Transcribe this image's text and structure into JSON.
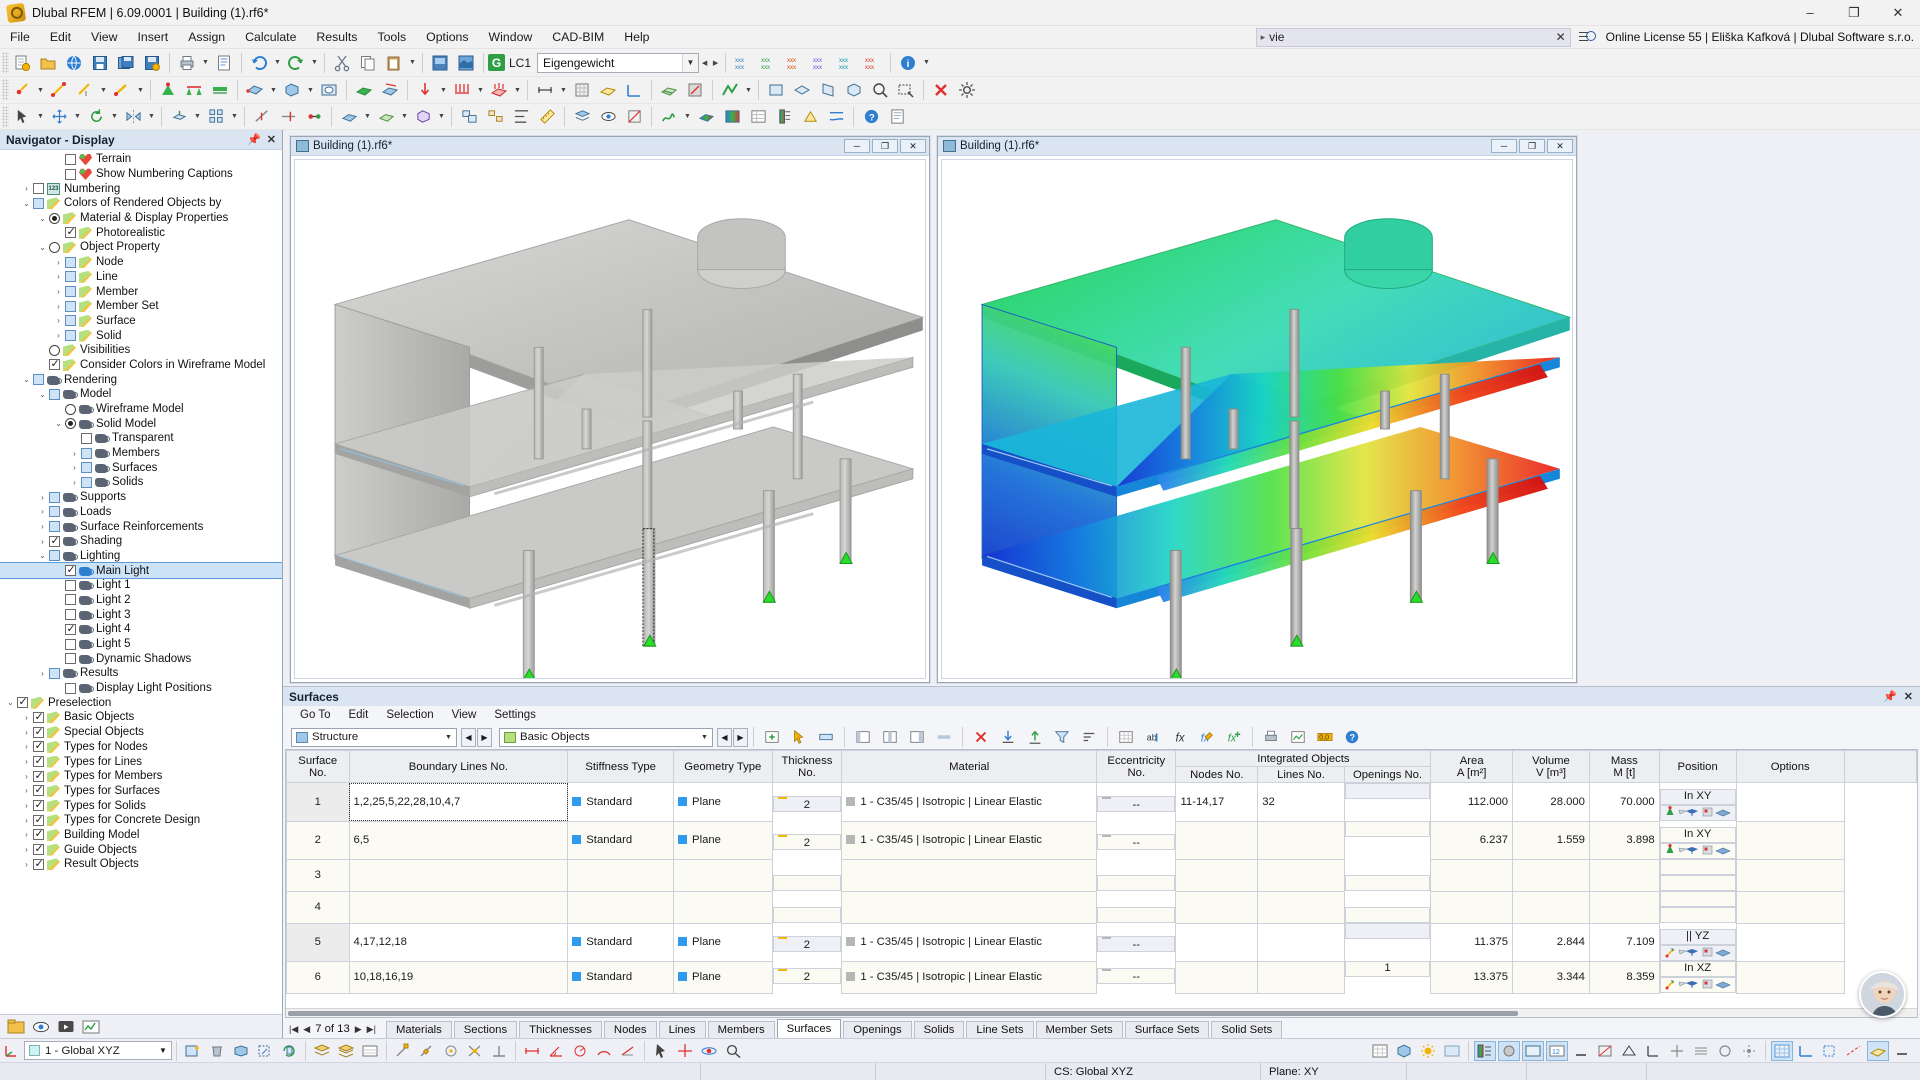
{
  "window": {
    "title": "Dlubal RFEM | 6.09.0001 | Building (1).rf6*",
    "minimize": "–",
    "restore": "❐",
    "close": "✕"
  },
  "menubar": {
    "items": [
      "File",
      "Edit",
      "View",
      "Insert",
      "Assign",
      "Calculate",
      "Results",
      "Tools",
      "Options",
      "Window",
      "CAD-BIM",
      "Help"
    ],
    "search": {
      "value": "vie",
      "clear_label": "✕",
      "arrow": "▸"
    },
    "license": "Online License 55 | Eliška Kafková | Dlubal Software s.r.o.",
    "license_icon": "license-search-icon"
  },
  "toolbar": {
    "load_case": {
      "badge": "G",
      "code": "LC1",
      "value": "Eigengewicht"
    }
  },
  "navigator": {
    "title": "Navigator - Display",
    "tools": [
      "pin-icon",
      "close-icon"
    ],
    "items": [
      {
        "label": "Terrain",
        "indent": 3,
        "ctrl": "checkbox",
        "checked": false,
        "icon": "terrain-icon",
        "expander": ""
      },
      {
        "label": "Show Numbering Captions",
        "indent": 3,
        "ctrl": "checkbox",
        "checked": false,
        "icon": "terrain-icon",
        "expander": ""
      },
      {
        "label": "Numbering",
        "indent": 1,
        "ctrl": "checkbox",
        "checked": false,
        "icon": "numbering-icon",
        "expander": "collapsed"
      },
      {
        "label": "Colors of Rendered Objects by",
        "indent": 1,
        "ctrl": "checkbox-blue",
        "checked": false,
        "icon": "pencil-icon",
        "expander": "expanded"
      },
      {
        "label": "Material & Display Properties",
        "indent": 2,
        "ctrl": "radio",
        "checked": true,
        "icon": "pencil-icon",
        "expander": "expanded"
      },
      {
        "label": "Photorealistic",
        "indent": 3,
        "ctrl": "checkbox",
        "checked": true,
        "icon": "pencil-icon",
        "expander": ""
      },
      {
        "label": "Object Property",
        "indent": 2,
        "ctrl": "radio",
        "checked": false,
        "icon": "pencil-icon",
        "expander": "expanded"
      },
      {
        "label": "Node",
        "indent": 3,
        "ctrl": "checkbox-blue",
        "checked": false,
        "icon": "pencil-icon",
        "expander": "collapsed"
      },
      {
        "label": "Line",
        "indent": 3,
        "ctrl": "checkbox-blue",
        "checked": false,
        "icon": "pencil-icon",
        "expander": "collapsed"
      },
      {
        "label": "Member",
        "indent": 3,
        "ctrl": "checkbox-blue",
        "checked": false,
        "icon": "pencil-icon",
        "expander": "collapsed"
      },
      {
        "label": "Member Set",
        "indent": 3,
        "ctrl": "checkbox-blue",
        "checked": false,
        "icon": "pencil-icon",
        "expander": "collapsed"
      },
      {
        "label": "Surface",
        "indent": 3,
        "ctrl": "checkbox-blue",
        "checked": false,
        "icon": "pencil-icon",
        "expander": "collapsed"
      },
      {
        "label": "Solid",
        "indent": 3,
        "ctrl": "checkbox-blue",
        "checked": false,
        "icon": "pencil-icon",
        "expander": "collapsed"
      },
      {
        "label": "Visibilities",
        "indent": 2,
        "ctrl": "radio",
        "checked": false,
        "icon": "pencil-icon",
        "expander": ""
      },
      {
        "label": "Consider Colors in Wireframe Model",
        "indent": 2,
        "ctrl": "checkbox",
        "checked": true,
        "icon": "pencil-icon",
        "expander": ""
      },
      {
        "label": "Rendering",
        "indent": 1,
        "ctrl": "checkbox-blue",
        "checked": false,
        "icon": "teapot-icon",
        "expander": "expanded"
      },
      {
        "label": "Model",
        "indent": 2,
        "ctrl": "checkbox-blue",
        "checked": false,
        "icon": "teapot-icon",
        "expander": "expanded"
      },
      {
        "label": "Wireframe Model",
        "indent": 3,
        "ctrl": "radio",
        "checked": false,
        "icon": "teapot-icon",
        "expander": ""
      },
      {
        "label": "Solid Model",
        "indent": 3,
        "ctrl": "radio",
        "checked": true,
        "icon": "teapot-icon",
        "expander": "expanded"
      },
      {
        "label": "Transparent",
        "indent": 4,
        "ctrl": "checkbox",
        "checked": false,
        "icon": "teapot-icon",
        "expander": ""
      },
      {
        "label": "Members",
        "indent": 4,
        "ctrl": "checkbox-blue",
        "checked": false,
        "icon": "teapot-icon",
        "expander": "collapsed"
      },
      {
        "label": "Surfaces",
        "indent": 4,
        "ctrl": "checkbox-blue",
        "checked": false,
        "icon": "teapot-icon",
        "expander": "collapsed"
      },
      {
        "label": "Solids",
        "indent": 4,
        "ctrl": "checkbox-blue",
        "checked": false,
        "icon": "teapot-icon",
        "expander": "collapsed"
      },
      {
        "label": "Supports",
        "indent": 2,
        "ctrl": "checkbox-blue",
        "checked": false,
        "icon": "teapot-icon",
        "expander": "collapsed"
      },
      {
        "label": "Loads",
        "indent": 2,
        "ctrl": "checkbox-blue",
        "checked": false,
        "icon": "teapot-icon",
        "expander": "collapsed"
      },
      {
        "label": "Surface Reinforcements",
        "indent": 2,
        "ctrl": "checkbox-blue",
        "checked": false,
        "icon": "teapot-icon",
        "expander": "collapsed"
      },
      {
        "label": "Shading",
        "indent": 2,
        "ctrl": "checkbox",
        "checked": true,
        "icon": "teapot-icon",
        "expander": "collapsed"
      },
      {
        "label": "Lighting",
        "indent": 2,
        "ctrl": "checkbox-blue",
        "checked": false,
        "icon": "teapot-icon",
        "expander": "expanded"
      },
      {
        "label": "Main Light",
        "indent": 3,
        "ctrl": "checkbox",
        "checked": true,
        "icon": "teapot-blue-icon",
        "expander": "",
        "selected": true
      },
      {
        "label": "Light 1",
        "indent": 3,
        "ctrl": "checkbox",
        "checked": false,
        "icon": "teapot-icon",
        "expander": ""
      },
      {
        "label": "Light 2",
        "indent": 3,
        "ctrl": "checkbox",
        "checked": false,
        "icon": "teapot-icon",
        "expander": ""
      },
      {
        "label": "Light 3",
        "indent": 3,
        "ctrl": "checkbox",
        "checked": false,
        "icon": "teapot-icon",
        "expander": ""
      },
      {
        "label": "Light 4",
        "indent": 3,
        "ctrl": "checkbox",
        "checked": true,
        "icon": "teapot-icon",
        "expander": ""
      },
      {
        "label": "Light 5",
        "indent": 3,
        "ctrl": "checkbox",
        "checked": false,
        "icon": "teapot-icon",
        "expander": ""
      },
      {
        "label": "Dynamic Shadows",
        "indent": 3,
        "ctrl": "checkbox",
        "checked": false,
        "icon": "teapot-icon",
        "expander": ""
      },
      {
        "label": "Results",
        "indent": 2,
        "ctrl": "checkbox-blue",
        "checked": false,
        "icon": "teapot-icon",
        "expander": "collapsed"
      },
      {
        "label": "Display Light Positions",
        "indent": 3,
        "ctrl": "checkbox",
        "checked": false,
        "icon": "teapot-icon",
        "expander": ""
      },
      {
        "label": "Preselection",
        "indent": 0,
        "ctrl": "checkbox",
        "checked": true,
        "icon": "pencil-icon",
        "expander": "expanded"
      },
      {
        "label": "Basic Objects",
        "indent": 1,
        "ctrl": "checkbox",
        "checked": true,
        "icon": "pencil-icon",
        "expander": "collapsed"
      },
      {
        "label": "Special Objects",
        "indent": 1,
        "ctrl": "checkbox",
        "checked": true,
        "icon": "pencil-icon",
        "expander": "collapsed"
      },
      {
        "label": "Types for Nodes",
        "indent": 1,
        "ctrl": "checkbox",
        "checked": true,
        "icon": "pencil-icon",
        "expander": "collapsed"
      },
      {
        "label": "Types for Lines",
        "indent": 1,
        "ctrl": "checkbox",
        "checked": true,
        "icon": "pencil-icon",
        "expander": "collapsed"
      },
      {
        "label": "Types for Members",
        "indent": 1,
        "ctrl": "checkbox",
        "checked": true,
        "icon": "pencil-icon",
        "expander": "collapsed"
      },
      {
        "label": "Types for Surfaces",
        "indent": 1,
        "ctrl": "checkbox",
        "checked": true,
        "icon": "pencil-icon",
        "expander": "collapsed"
      },
      {
        "label": "Types for Solids",
        "indent": 1,
        "ctrl": "checkbox",
        "checked": true,
        "icon": "pencil-icon",
        "expander": "collapsed"
      },
      {
        "label": "Types for Concrete Design",
        "indent": 1,
        "ctrl": "checkbox",
        "checked": true,
        "icon": "pencil-icon",
        "expander": "collapsed"
      },
      {
        "label": "Building Model",
        "indent": 1,
        "ctrl": "checkbox",
        "checked": true,
        "icon": "pencil-icon",
        "expander": "collapsed"
      },
      {
        "label": "Guide Objects",
        "indent": 1,
        "ctrl": "checkbox",
        "checked": true,
        "icon": "pencil-icon",
        "expander": "collapsed"
      },
      {
        "label": "Result Objects",
        "indent": 1,
        "ctrl": "checkbox",
        "checked": true,
        "icon": "pencil-icon",
        "expander": "collapsed"
      }
    ]
  },
  "views": [
    {
      "title": "Building (1).rf6*",
      "kind": "solid-model"
    },
    {
      "title": "Building (1).rf6*",
      "kind": "results-contour"
    }
  ],
  "surfaces_panel": {
    "title": "Surfaces",
    "menu": [
      "Go To",
      "Edit",
      "Selection",
      "View",
      "Settings"
    ],
    "structure_combo": "Structure",
    "objects_combo": "Basic Objects",
    "columns": {
      "surface_no": "Surface\nNo.",
      "surface_no_l1": "Surface",
      "surface_no_l2": "No.",
      "boundary_lines": "Boundary Lines No.",
      "stiffness_type": "Stiffness Type",
      "geometry_type": "Geometry Type",
      "thickness_l1": "Thickness",
      "thickness_l2": "No.",
      "material": "Material",
      "eccentricity_l1": "Eccentricity",
      "eccentricity_l2": "No.",
      "integrated_objects": "Integrated Objects",
      "nodes_no": "Nodes No.",
      "lines_no": "Lines No.",
      "openings_no": "Openings No.",
      "area_l1": "Area",
      "area_l2": "A [m²]",
      "volume_l1": "Volume",
      "volume_l2": "V [m³]",
      "mass_l1": "Mass",
      "mass_l2": "M [t]",
      "position": "Position",
      "options": "Options"
    },
    "rows": [
      {
        "no": "1",
        "boundary": "1,2,25,5,22,28,10,4,7",
        "stiffness": "Standard",
        "geometry": "Plane",
        "thickness": "2",
        "material": "1 - C35/45 | Isotropic | Linear Elastic",
        "ecc": "--",
        "nodes": "11-14,17",
        "lines": "32",
        "openings": "",
        "area": "112.000",
        "volume": "28.000",
        "mass": "70.000",
        "position": "In XY",
        "has_options": true,
        "focused": true
      },
      {
        "no": "2",
        "boundary": "6,5",
        "stiffness": "Standard",
        "geometry": "Plane",
        "thickness": "2",
        "material": "1 - C35/45 | Isotropic | Linear Elastic",
        "ecc": "--",
        "nodes": "",
        "lines": "",
        "openings": "",
        "area": "6.237",
        "volume": "1.559",
        "mass": "3.898",
        "position": "In XY",
        "has_options": true
      },
      {
        "no": "3",
        "boundary": "",
        "stiffness": "",
        "geometry": "",
        "thickness": "",
        "material": "",
        "ecc": "",
        "nodes": "",
        "lines": "",
        "openings": "",
        "area": "",
        "volume": "",
        "mass": "",
        "position": "",
        "has_options": false
      },
      {
        "no": "4",
        "boundary": "",
        "stiffness": "",
        "geometry": "",
        "thickness": "",
        "material": "",
        "ecc": "",
        "nodes": "",
        "lines": "",
        "openings": "",
        "area": "",
        "volume": "",
        "mass": "",
        "position": "",
        "has_options": false
      },
      {
        "no": "5",
        "boundary": "4,17,12,18",
        "stiffness": "Standard",
        "geometry": "Plane",
        "thickness": "2",
        "material": "1 - C35/45 | Isotropic | Linear Elastic",
        "ecc": "--",
        "nodes": "",
        "lines": "",
        "openings": "",
        "area": "11.375",
        "volume": "2.844",
        "mass": "7.109",
        "position": "|| YZ",
        "has_options": true
      },
      {
        "no": "6",
        "boundary": "10,18,16,19",
        "stiffness": "Standard",
        "geometry": "Plane",
        "thickness": "2",
        "material": "1 - C35/45 | Isotropic | Linear Elastic",
        "ecc": "--",
        "nodes": "",
        "lines": "",
        "openings": "1",
        "area": "13.375",
        "volume": "3.344",
        "mass": "8.359",
        "position": "In XZ",
        "has_options": true
      }
    ],
    "pager": "7 of 13",
    "tabs": [
      "Materials",
      "Sections",
      "Thicknesses",
      "Nodes",
      "Lines",
      "Members",
      "Surfaces",
      "Openings",
      "Solids",
      "Line Sets",
      "Member Sets",
      "Surface Sets",
      "Solid Sets"
    ],
    "active_tab": "Surfaces"
  },
  "bottombar": {
    "coordinate_system": "1 - Global XYZ"
  },
  "statusbar": {
    "cs": "CS: Global XYZ",
    "plane": "Plane: XY"
  }
}
